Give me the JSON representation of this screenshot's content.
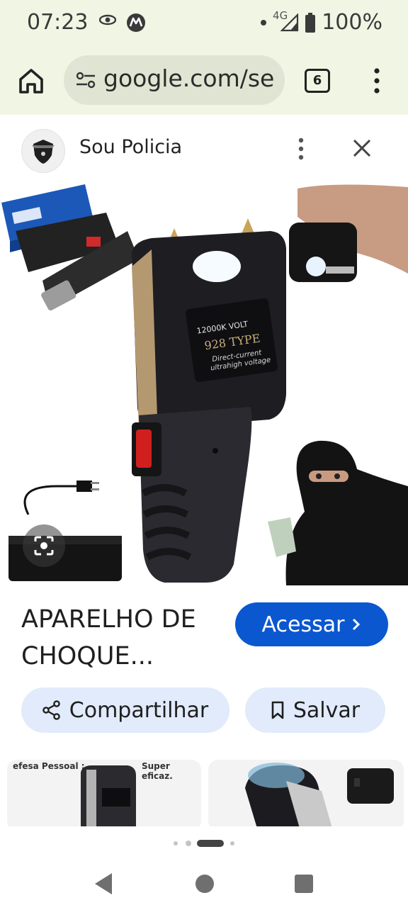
{
  "status_bar": {
    "time": "07:23",
    "network": "4G",
    "battery": "100%"
  },
  "browser": {
    "url": "google.com/se",
    "tab_count": "6"
  },
  "result": {
    "site_name": "Sou Policia",
    "title_line1": "APARELHO DE",
    "title_line2": "CHOQUE...",
    "access_label": "Acessar",
    "image_labels": {
      "volt": "12000K VOLT",
      "type": "928 TYPE",
      "sub1": "Direct-current",
      "sub2": "ultrahigh voltage"
    }
  },
  "actions": {
    "share_label": "Compartilhar",
    "save_label": "Salvar"
  },
  "related": {
    "thumb1_text": "efesa Pessoal :",
    "thumb1_text2": "Super eficaz."
  },
  "colors": {
    "accent_blue": "#0b57d0",
    "chip_bg": "#e2ebfb",
    "chrome_bg": "#f1f5e4"
  }
}
